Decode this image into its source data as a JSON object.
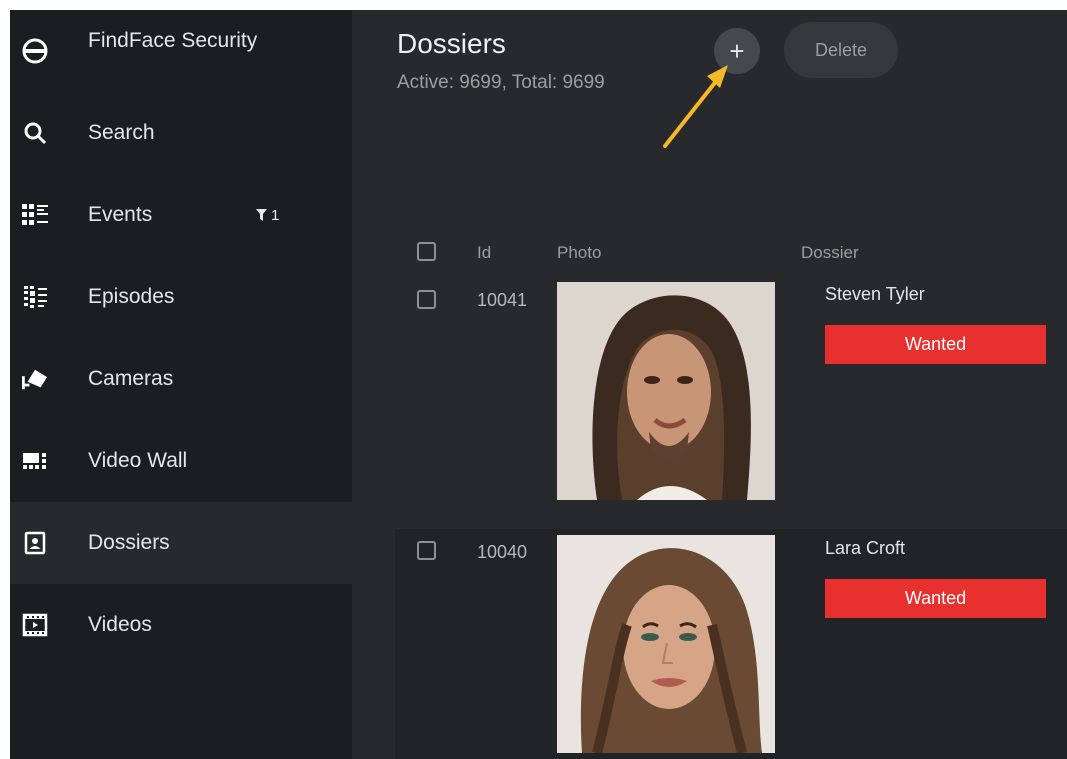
{
  "app": {
    "title": "FindFace Security"
  },
  "sidebar": {
    "items": [
      {
        "label": "Search",
        "icon": "search-icon"
      },
      {
        "label": "Events",
        "icon": "events-icon",
        "badge": "1"
      },
      {
        "label": "Episodes",
        "icon": "episodes-icon"
      },
      {
        "label": "Cameras",
        "icon": "camera-icon"
      },
      {
        "label": "Video Wall",
        "icon": "video-wall-icon"
      },
      {
        "label": "Dossiers",
        "icon": "dossier-icon",
        "active": true
      },
      {
        "label": "Videos",
        "icon": "videos-icon"
      }
    ]
  },
  "header": {
    "title": "Dossiers",
    "subtitle": "Active: 9699, Total: 9699",
    "add_label": "+",
    "delete_label": "Delete"
  },
  "table": {
    "columns": [
      "Id",
      "Photo",
      "Dossier"
    ],
    "rows": [
      {
        "id": "10041",
        "name": "Steven Tyler",
        "status": "Wanted"
      },
      {
        "id": "10040",
        "name": "Lara Croft",
        "status": "Wanted"
      }
    ]
  },
  "colors": {
    "sidebar": "#1b1d20",
    "background": "#27292d",
    "status_wanted": "#e8312f",
    "annotation_arrow": "#f4b829"
  }
}
